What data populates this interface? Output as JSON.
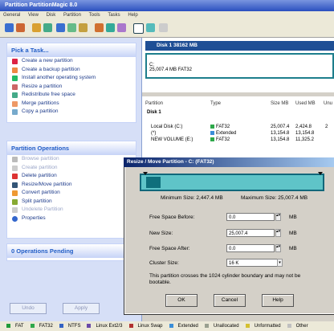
{
  "window": {
    "title": "Partition PartitionMagic 8.0"
  },
  "menu": [
    "General",
    "View",
    "Disk",
    "Partition",
    "Tools",
    "Tasks",
    "Help"
  ],
  "left": {
    "tasks_title": "Pick a Task...",
    "tasks": [
      "Create a new partition",
      "Create a backup partition",
      "Install another operating system",
      "Resize a partition",
      "Redistribute free space",
      "Merge partitions",
      "Copy a partition"
    ],
    "ops_title": "Partition Operations",
    "ops": [
      {
        "label": "Browse partition",
        "disabled": true
      },
      {
        "label": "Create partition",
        "disabled": true
      },
      {
        "label": "Delete partition",
        "disabled": false
      },
      {
        "label": "Resize/Move partition",
        "disabled": false
      },
      {
        "label": "Convert partition",
        "disabled": false
      },
      {
        "label": "Split partition",
        "disabled": false
      },
      {
        "label": "Undelete Partition",
        "disabled": true
      },
      {
        "label": "Properties",
        "disabled": false
      }
    ],
    "pending": "0 Operations Pending",
    "undo": "Undo",
    "apply": "Apply"
  },
  "disk": {
    "header": "Disk 1 38162 MB",
    "drive_letter": "C:",
    "drive_info": "25,007.4 MB  FAT32"
  },
  "list": {
    "headers": [
      "Partition",
      "Type",
      "Size MB",
      "Used MB",
      "Unu"
    ],
    "group": "Disk 1",
    "rows": [
      {
        "name": "Local Disk (C:)",
        "type": "FAT32",
        "size": "25,007.4",
        "used": "2,424.8",
        "extra": "2"
      },
      {
        "name": "(*)",
        "type": "Extended",
        "size": "13,154.8",
        "used": "13,154.8",
        "extra": ""
      },
      {
        "name": "NEW VOLUME (E:)",
        "type": "FAT32",
        "size": "13,154.8",
        "used": "11,325.2",
        "extra": ""
      }
    ]
  },
  "dialog": {
    "title": "Resize / Move Partition - C: (FAT32)",
    "min_size": "Minimum Size: 2,447.4 MB",
    "max_size": "Maximum Size: 25,007.4 MB",
    "free_before_label": "Free Space Before:",
    "free_before_value": "0.0",
    "new_size_label": "New Size:",
    "new_size_value": "25,007.4",
    "free_after_label": "Free Space After:",
    "free_after_value": "0.0",
    "cluster_label": "Cluster Size:",
    "cluster_value": "16 K",
    "unit": "MB",
    "note": "This partition crosses the 1024 cylinder boundary and may not be bootable.",
    "ok": "OK",
    "cancel": "Cancel",
    "help": "Help"
  },
  "legend": [
    {
      "label": "FAT",
      "color": "#1f9a3a"
    },
    {
      "label": "FAT32",
      "color": "#2ea84a"
    },
    {
      "label": "NTFS",
      "color": "#3363c4"
    },
    {
      "label": "Linux Ext2/3",
      "color": "#6a4aa8"
    },
    {
      "label": "Linux Swap",
      "color": "#b03030"
    },
    {
      "label": "Extended",
      "color": "#3b8ed8"
    },
    {
      "label": "Unallocated",
      "color": "#9aa090"
    },
    {
      "label": "Unformatted",
      "color": "#d4c030"
    },
    {
      "label": "Other",
      "color": "#c0c0c0"
    }
  ]
}
